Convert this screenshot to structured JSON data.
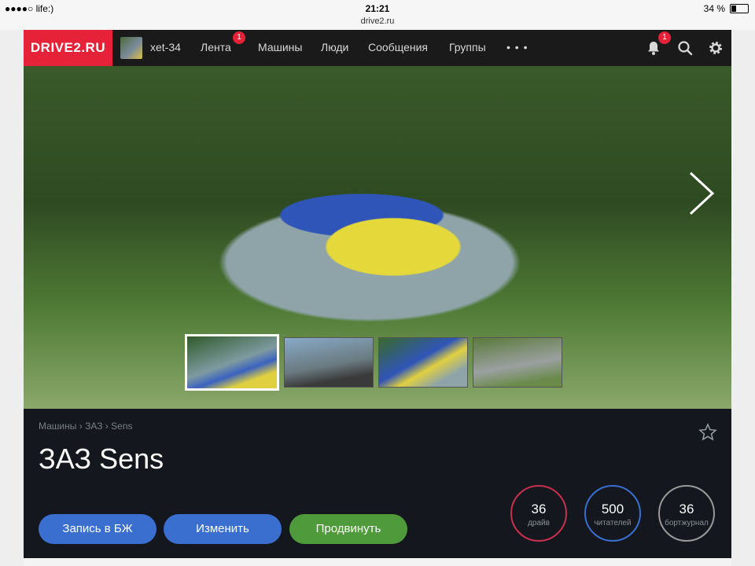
{
  "statusbar": {
    "carrier": "●●●●○ life:) ",
    "time": "21:21",
    "url": "drive2.ru",
    "battery": "34 %"
  },
  "nav": {
    "logo": "DRIVE2.RU",
    "username": "xet-34",
    "items": [
      {
        "label": "Лента",
        "badge": "1"
      },
      {
        "label": "Машины"
      },
      {
        "label": "Люди"
      },
      {
        "label": "Сообщения"
      },
      {
        "label": "Группы"
      }
    ],
    "more": "• • •",
    "notifications_badge": "1"
  },
  "breadcrumb": {
    "items": [
      "Машины",
      "ЗАЗ",
      "Sens"
    ],
    "separator": "›"
  },
  "car": {
    "title": "ЗАЗ Sens"
  },
  "buttons": {
    "logbook": "Запись в БЖ",
    "edit": "Изменить",
    "promote": "Продвинуть"
  },
  "stats": [
    {
      "value": "36",
      "label": "драйв"
    },
    {
      "value": "500",
      "label": "читателей"
    },
    {
      "value": "36",
      "label": "бортжурнал"
    }
  ],
  "colors": {
    "brand": "#e52238",
    "blue": "#3a6fd0",
    "green": "#4f9a3a",
    "stat_drive": "#c8304f",
    "stat_readers": "#3a6fd0",
    "stat_log": "#9a9a9a"
  },
  "icons": [
    "bell-icon",
    "search-icon",
    "gear-icon",
    "chevron-right-icon",
    "star-icon"
  ],
  "gallery": {
    "thumbnails": 4,
    "active_index": 0
  }
}
